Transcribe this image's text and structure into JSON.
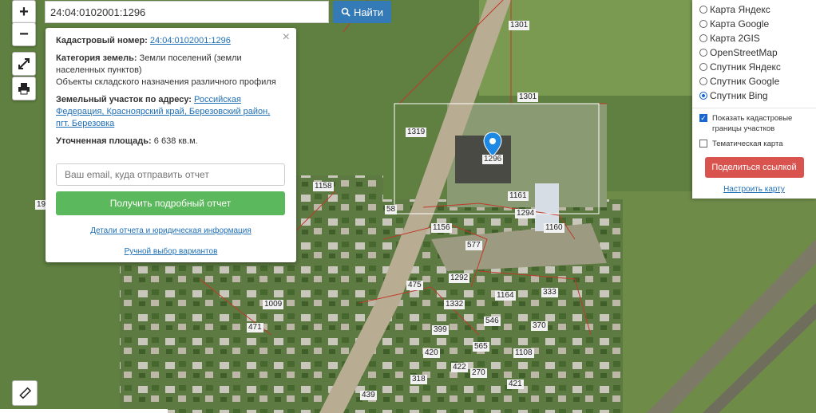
{
  "search": {
    "value": "24:04:0102001:1296",
    "button_label": "Найти"
  },
  "controls": {
    "zoom_in": "+",
    "zoom_out": "−"
  },
  "popup": {
    "close": "×",
    "cadastral_label": "Кадастровый номер:",
    "cadastral_value": "24:04:0102001:1296",
    "category_label": "Категория земель:",
    "category_value": "Земли поселений (земли населенных пунктов)",
    "purpose": "Объекты складского назначения различного профиля",
    "address_label": "Земельный участок по адресу:",
    "address_value": "Российская Федерация, Красноярский край, Березовский район, пгт. Березовка",
    "area_label": "Уточненная площадь:",
    "area_value": "6 638 кв.м.",
    "email_placeholder": "Ваш email, куда отправить отчет",
    "report_button": "Получить подробный отчет",
    "details_link": "Детали отчета и юридическая информация",
    "manual_link": "Ручной выбор вариантов"
  },
  "layers": {
    "options": [
      {
        "label": "Карта Яндекс",
        "selected": false
      },
      {
        "label": "Карта Google",
        "selected": false
      },
      {
        "label": "Карта 2GIS",
        "selected": false
      },
      {
        "label": "OpenStreetMap",
        "selected": false
      },
      {
        "label": "Спутник Яндекс",
        "selected": false
      },
      {
        "label": "Спутник Google",
        "selected": false
      },
      {
        "label": "Спутник Bing",
        "selected": true
      }
    ],
    "show_borders": {
      "label": "Показать кадастровые границы участков",
      "checked": true
    },
    "thematic": {
      "label": "Тематическая карта",
      "checked": false
    },
    "share_button": "Поделиться ссылкой",
    "setup_link": "Настроить карту"
  },
  "marker": {
    "label": "1296"
  },
  "plots": [
    "1301",
    "1301",
    "1319",
    "1161",
    "1294",
    "1160",
    "1156",
    "577",
    "1292",
    "475",
    "1332",
    "399",
    "420",
    "565",
    "546",
    "1164",
    "333",
    "370",
    "1108",
    "421",
    "318",
    "422",
    "270",
    "439",
    "1009",
    "471",
    "1158",
    "58",
    "19"
  ],
  "colors": {
    "accent": "#337ab7",
    "green": "#5cb85c",
    "red": "#d9534f",
    "border": "#c0392b"
  }
}
